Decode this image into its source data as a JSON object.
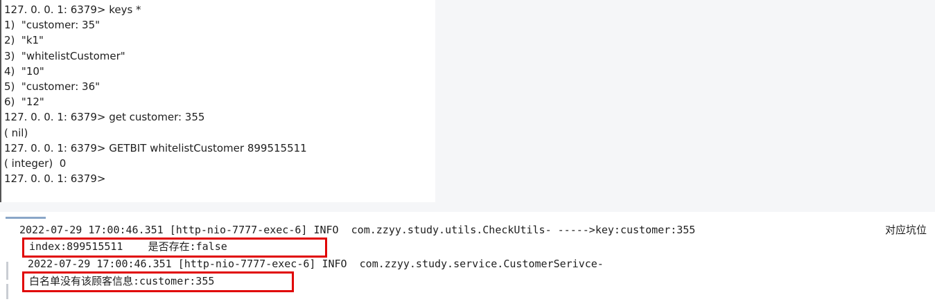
{
  "terminal": {
    "lines": [
      "127. 0. 0. 1: 6379> keys *",
      "1)  \"customer: 35\"",
      "2)  \"k1\"",
      "3)  \"whitelistCustomer\"",
      "4)  \"10\"",
      "5)  \"customer: 36\"",
      "6)  \"12\"",
      "127. 0. 0. 1: 6379> get customer: 355",
      "( nil)",
      "127. 0. 0. 1: 6379> GETBIT whitelistCustomer 899515511",
      "( integer)  0",
      "127. 0. 0. 1: 6379>"
    ]
  },
  "console": {
    "log1": "2022-07-29 17:00:46.351 [http-nio-7777-exec-6] INFO  com.zzyy.study.utils.CheckUtils- ----->key:customer:355",
    "log1_note": "对应坑位",
    "log1_cont": "index:899515511    是否存在:false",
    "log2": "2022-07-29 17:00:46.351 [http-nio-7777-exec-6] INFO  com.zzyy.study.service.CustomerSerivce-",
    "log2_cont": "白名单没有该顾客信息:customer:355"
  },
  "colors": {
    "highlight": "#e00000",
    "terminal_text": "#1e1e1e",
    "background_gray": "#f5f6f8"
  }
}
